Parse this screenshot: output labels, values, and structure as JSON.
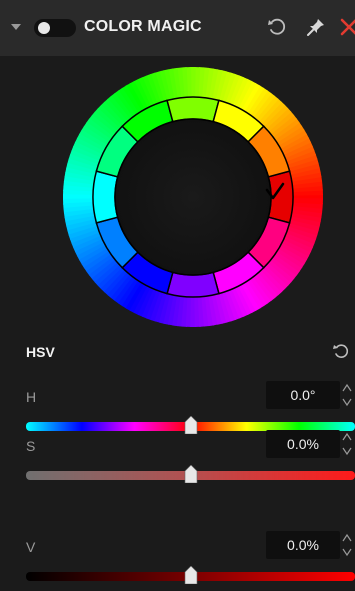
{
  "header": {
    "title": "COLOR MAGIC"
  },
  "section": {
    "label": "HSV"
  },
  "params": {
    "h": {
      "label": "H",
      "value": "0.0°"
    },
    "s": {
      "label": "S",
      "value": "0.0%"
    },
    "v": {
      "label": "V",
      "value": "0.0%"
    }
  },
  "swatches": {
    "count": 12,
    "selected": "red",
    "selected_marker": "checkmark-icon"
  },
  "colors": {
    "header_bg": "#2a2a2a",
    "panel_bg": "#1b1b1b",
    "close": "#e23b30"
  },
  "icons": [
    "chevron-down-icon",
    "toggle-switch",
    "reset-icon",
    "pin-icon",
    "close-icon",
    "checkmark-icon"
  ]
}
